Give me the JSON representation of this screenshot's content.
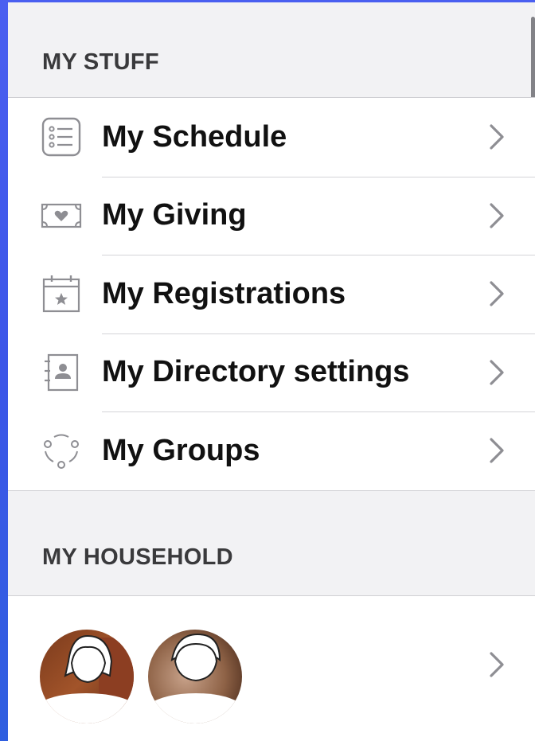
{
  "my_stuff": {
    "header": "MY STUFF",
    "items": [
      {
        "label": "My Schedule",
        "icon": "schedule-list-icon"
      },
      {
        "label": "My Giving",
        "icon": "giving-heart-icon"
      },
      {
        "label": "My Registrations",
        "icon": "registrations-calendar-icon"
      },
      {
        "label": "My Directory settings",
        "icon": "directory-contact-icon"
      },
      {
        "label": "My Groups",
        "icon": "groups-icon"
      }
    ]
  },
  "my_household": {
    "header": "MY HOUSEHOLD",
    "members": [
      {
        "avatar": "member-avatar-1"
      },
      {
        "avatar": "member-avatar-2"
      }
    ]
  },
  "colors": {
    "background": "#f2f2f4",
    "list_background": "#ffffff",
    "text": "#111111",
    "header_text": "#3a3a3c",
    "icon_gray": "#8e8e93",
    "chevron": "#8e8e93",
    "frame_blue": "#3f57e6"
  }
}
